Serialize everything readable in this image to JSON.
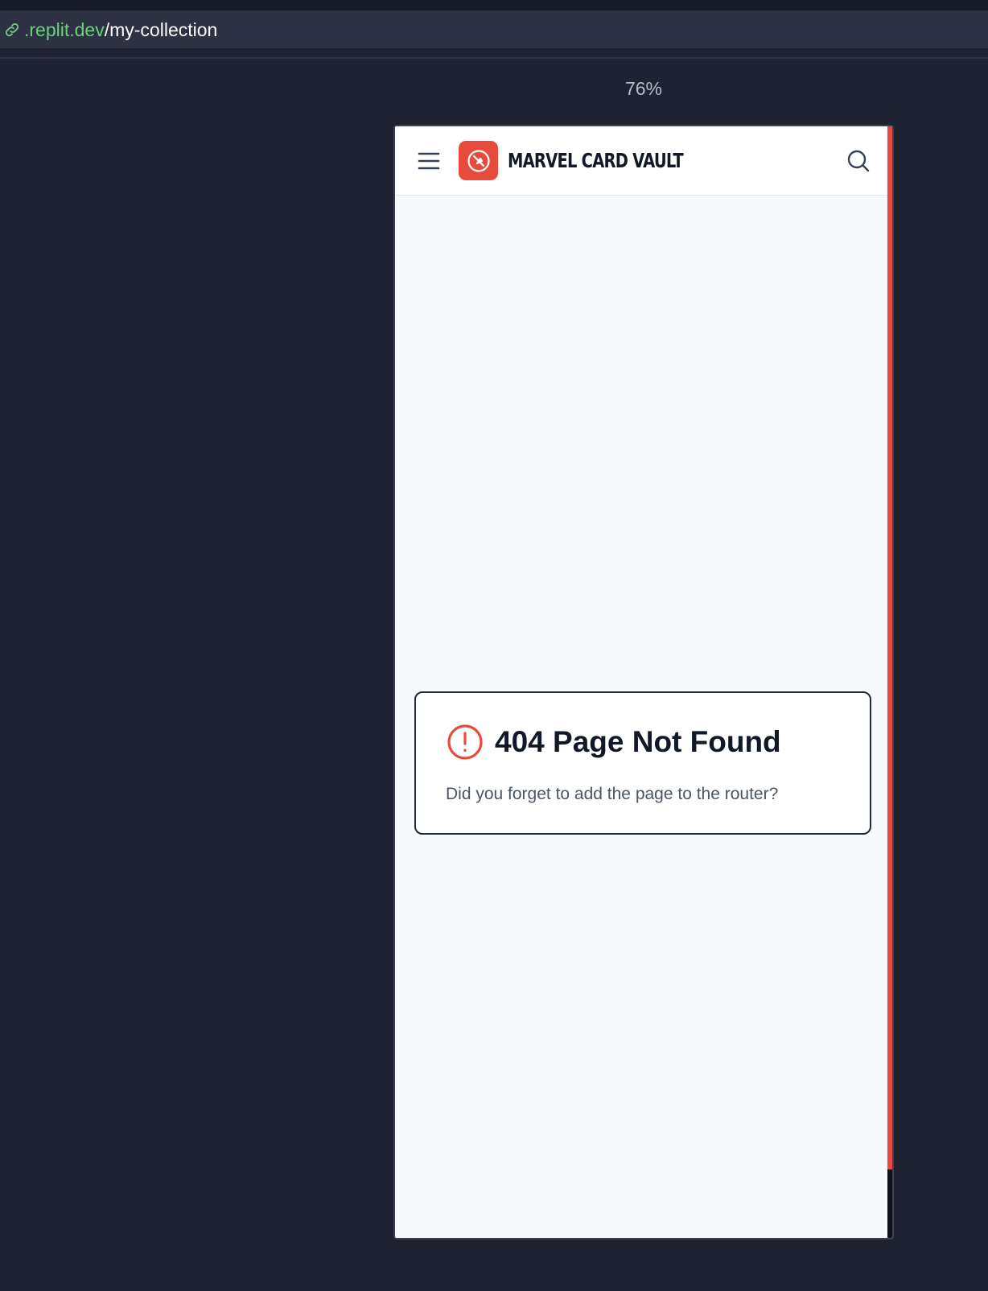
{
  "browser": {
    "url_host": ".replit.dev",
    "url_path": "/my-collection",
    "link_icon": "link-icon"
  },
  "preview": {
    "zoom": "76%"
  },
  "app": {
    "brand": "MARVEL CARD VAULT",
    "menu_icon": "hamburger-menu-icon",
    "logo_icon": "shield-logo-icon",
    "search_icon": "search-icon",
    "accent_color": "#e84a3b"
  },
  "error_card": {
    "icon": "alert-circle-icon",
    "title": "404 Page Not Found",
    "description": "Did you forget to add the page to the router?"
  }
}
